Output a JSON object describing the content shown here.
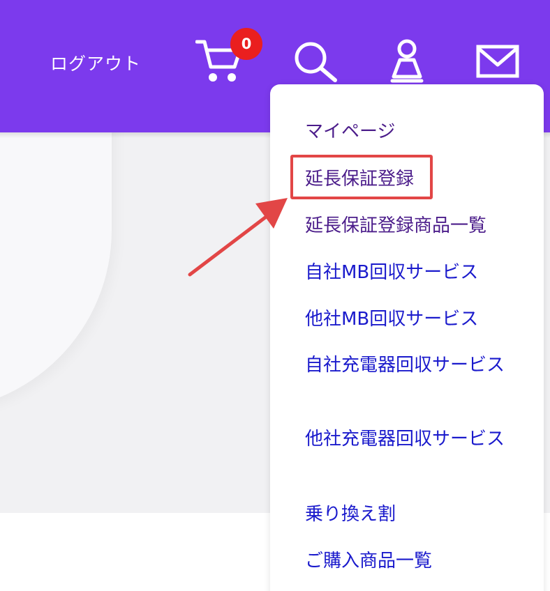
{
  "header": {
    "logout_label": "ログアウト",
    "cart_count": "0",
    "icons": [
      "cart-icon",
      "search-icon",
      "user-icon",
      "mail-icon"
    ]
  },
  "dropdown": {
    "items": [
      {
        "label": "マイページ"
      },
      {
        "label": "延長保証登録"
      },
      {
        "label": "延長保証登録商品一覧"
      },
      {
        "label": "自社MB回収サービス"
      },
      {
        "label": "他社MB回収サービス"
      },
      {
        "label": "自社充電器回収サービス"
      },
      {
        "label": "他社充電器回収サービス"
      },
      {
        "label": "乗り換え割"
      },
      {
        "label": "ご購入商品一覧"
      }
    ]
  },
  "colors": {
    "header": "#7c3aed",
    "badge": "#ea1f1f",
    "link": "#1a1acc",
    "visited_link": "#4b1c8a",
    "annotation": "#e24646"
  }
}
